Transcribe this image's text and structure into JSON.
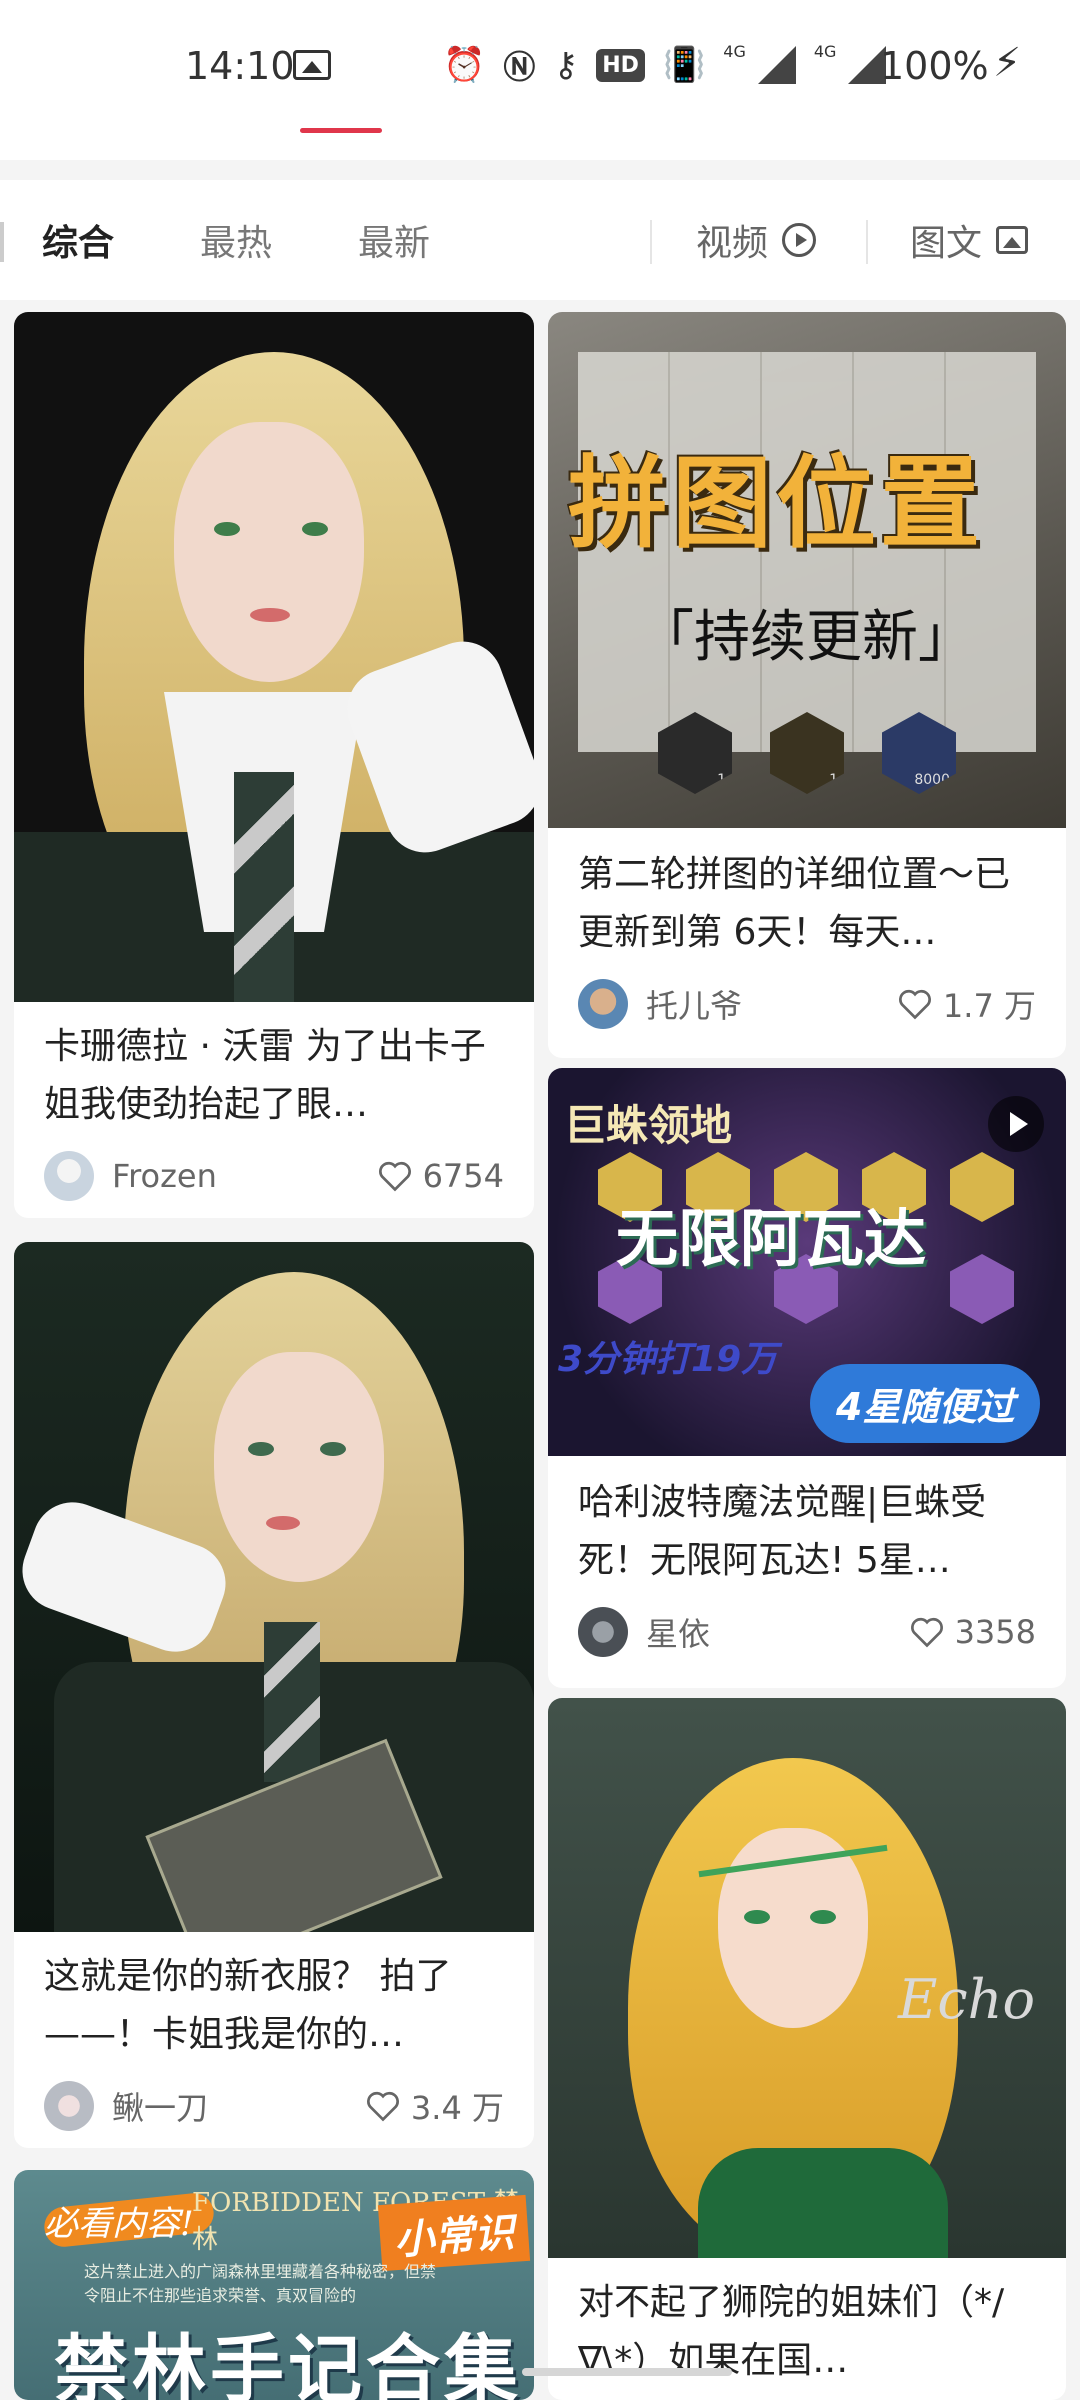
{
  "status_bar": {
    "time": "14:10",
    "battery": "100%",
    "network_labels": [
      "4G",
      "4G"
    ],
    "hd_label": "HD",
    "icons": [
      "gallery-icon",
      "alarm-icon",
      "nfc-icon",
      "key-icon",
      "hd-voice-icon",
      "vibrate-icon",
      "signal-icon",
      "charging-icon"
    ]
  },
  "filters": {
    "tabs": [
      {
        "label": "综合",
        "active": true
      },
      {
        "label": "最热",
        "active": false
      },
      {
        "label": "最新",
        "active": false
      }
    ],
    "video": "视频",
    "image_text": "图文"
  },
  "feed": {
    "cards": [
      {
        "title": "卡珊德拉 · 沃雷 为了出卡子姐我使劲抬起了眼…",
        "author": "Frozen",
        "likes": "6754",
        "image": "blonde-cosplay-portrait"
      },
      {
        "title": "第二轮拼图的详细位置～已更新到第 6天！每天…",
        "author": "托儿爷",
        "likes": "1.7 万",
        "image": "puzzle-location-cover",
        "cover_title": "拼图位置",
        "cover_sub": "「持续更新」",
        "cover_badges": [
          "?",
          "1",
          "1",
          "8000"
        ]
      },
      {
        "title": "哈利波特魔法觉醒|巨蛛受死！无限阿瓦达! 5星…",
        "author": "星依",
        "likes": "3358",
        "image": "spider-territory-cover",
        "is_video": true,
        "cover_title": "巨蛛领地",
        "cover_big": "无限阿瓦达",
        "cover_small": "3分钟打19万",
        "cover_badge": "4星随便过"
      },
      {
        "title": "这就是你的新衣服？ 拍了——！卡姐我是你的…",
        "author": "鳅一刀",
        "likes": "3.4 万",
        "image": "blonde-cosplay-with-book"
      },
      {
        "title": "对不起了狮院的姐妹们（*/∇\\*）如果在国…",
        "author": "",
        "likes": "",
        "image": "illustrated-blonde-girl",
        "signature": "Echo"
      },
      {
        "title": "",
        "author": "",
        "likes": "",
        "image": "forbidden-forest-notes",
        "cover_script": "必看内容!",
        "cover_title": "FORBIDDEN FOREST 禁林",
        "cover_badge": "小常识",
        "cover_text": "这片禁止进入的广阔森林里埋藏着各种秘密，但禁令阻止不住那些追求荣誉、真双冒险的",
        "cover_big": "禁林手记合集"
      }
    ]
  },
  "colors": {
    "accent": "#e0364b",
    "background": "#f4f4f4",
    "card": "#ffffff"
  }
}
